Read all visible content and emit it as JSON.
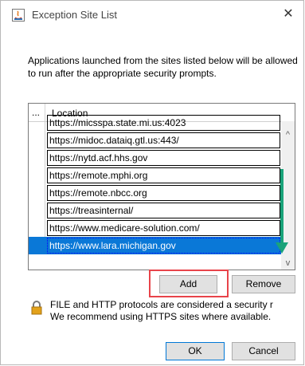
{
  "window": {
    "title": "Exception Site List",
    "close_glyph": "✕"
  },
  "description": "Applications launched from the sites listed below will be allowed to run after the appropriate security prompts.",
  "list": {
    "col_stub": "...",
    "col_location": "Location",
    "rows": [
      "https://micsspa.state.mi.us:4023",
      "https://midoc.dataiq.gtl.us:443/",
      "https://nytd.acf.hhs.gov",
      "https://remote.mphi.org",
      "https://remote.nbcc.org",
      "https://treasinternal/",
      "https://www.medicare-solution.com/",
      "https://www.lara.michigan.gov"
    ],
    "selected_index": 7
  },
  "buttons": {
    "add": "Add",
    "remove": "Remove",
    "ok": "OK",
    "cancel": "Cancel"
  },
  "note": {
    "line1": "FILE and HTTP protocols are considered a security r",
    "line2": "We recommend using HTTPS sites where available."
  },
  "colors": {
    "selection": "#0a78d7",
    "annotation_red": "#e8444a",
    "annotation_green": "#1aa37a"
  },
  "icons": {
    "app": "java-app-icon",
    "lock": "lock-icon",
    "scroll_up": "chevron-up-icon",
    "scroll_down": "chevron-down-icon",
    "annotation": "down-arrow-icon"
  }
}
